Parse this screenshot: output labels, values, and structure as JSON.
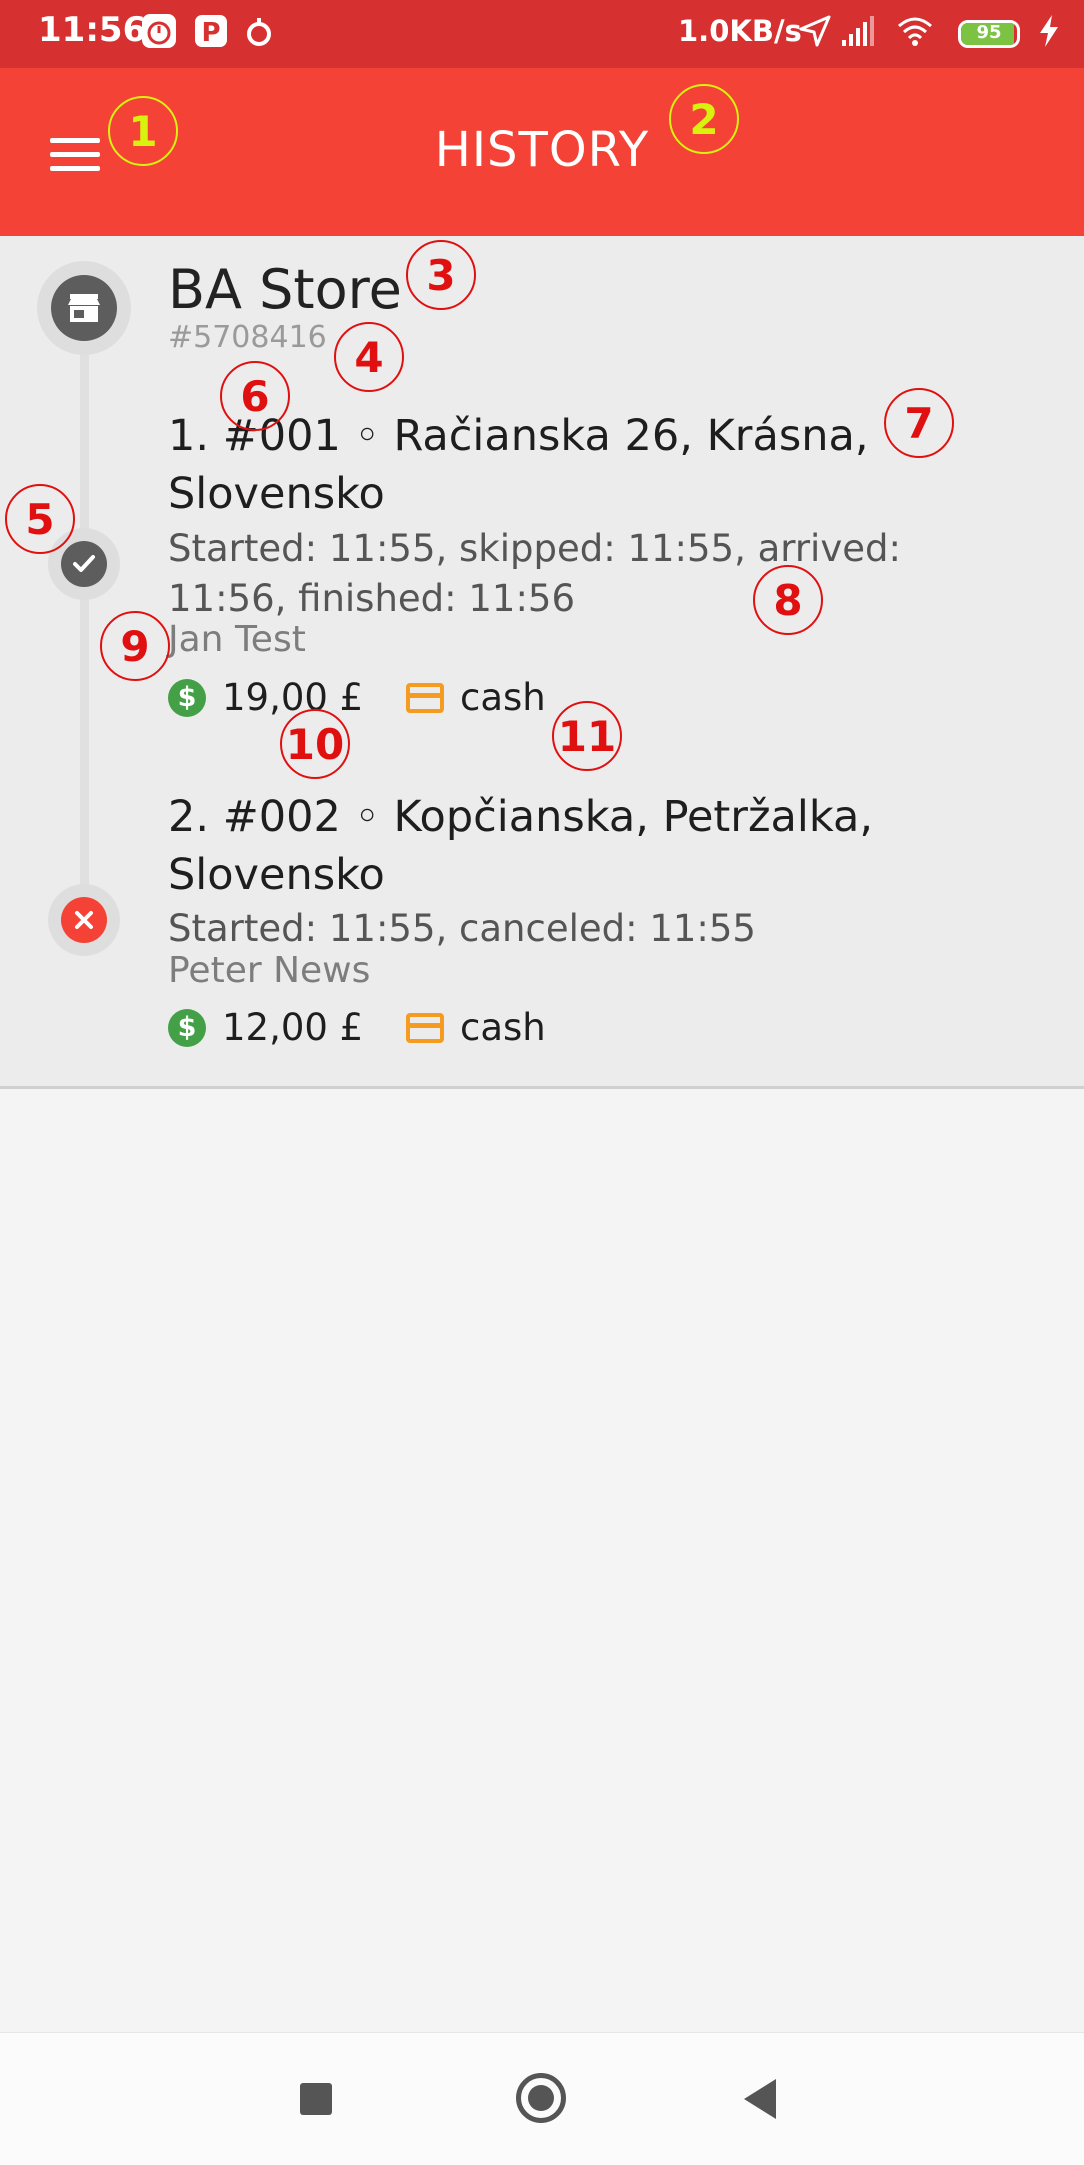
{
  "status_bar": {
    "time": "11:56",
    "net_speed": "1.0KB/s",
    "battery": "95",
    "battery_level": 0.95
  },
  "app_bar": {
    "title": "HISTORY"
  },
  "route": {
    "store_name": "BA Store",
    "route_id": "#5708416",
    "stops": [
      {
        "title": "1. #001 ◦ Račianska 26, Krásna, Slovensko",
        "times": "Started: 11:55, skipped: 11:55, arrived: 11:56, finished: 11:56",
        "customer": "Jan Test",
        "price": "19,00 £",
        "payment": "cash",
        "status": "finished"
      },
      {
        "title": "2. #002 ◦ Kopčianska, Petržalka, Slovensko",
        "times": "Started: 11:55, canceled: 11:55",
        "customer": "Peter News",
        "price": "12,00 £",
        "payment": "cash",
        "status": "canceled"
      }
    ]
  },
  "annotations": [
    "1",
    "2",
    "3",
    "4",
    "5",
    "6",
    "7",
    "8",
    "9",
    "10",
    "11"
  ],
  "colors": {
    "status_bar": "#d63030",
    "app_bar": "#f44336",
    "card_bg": "#ececec",
    "page_bg": "#f4f4f4",
    "money_green": "#43a047",
    "card_orange": "#f59b1f",
    "cancel_red": "#f44336",
    "annotation_yellow": "#d7f20e",
    "annotation_red": "#e01010"
  }
}
